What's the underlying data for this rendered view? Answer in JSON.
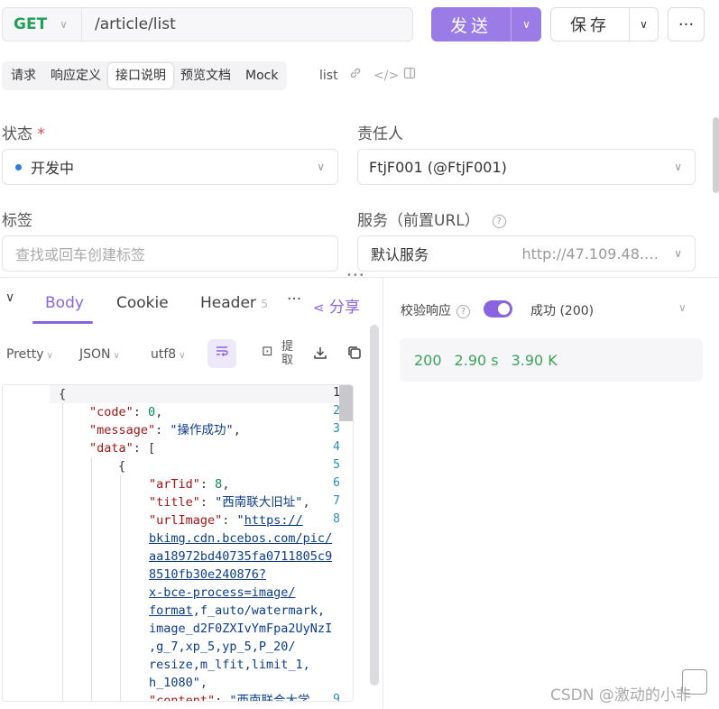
{
  "request": {
    "method": "GET",
    "url": "/article/list",
    "send_label": "发送",
    "save_label": "保存",
    "more_label": "···"
  },
  "tabs": [
    "请求",
    "响应定义",
    "接口说明",
    "预览文档",
    "Mock"
  ],
  "active_tab": "接口说明",
  "tab_extra": "list",
  "form": {
    "status_label": "状态",
    "status_required": "*",
    "status_value": "开发中",
    "owner_label": "责任人",
    "owner_value": "FtjF001 (@FtjF001)",
    "tags_label": "标签",
    "tags_placeholder": "查找或回车创建标签",
    "service_label": "服务（前置URL）",
    "service_value": "默认服务",
    "service_url": "http://47.109.48.…"
  },
  "response_tabs": {
    "body": "Body",
    "cookie": "Cookie",
    "header": "Header",
    "header_count": "5",
    "more": "···",
    "share": "分享"
  },
  "format_bar": {
    "pretty": "Pretty",
    "json": "JSON",
    "encoding": "utf8",
    "extract": "提取"
  },
  "code_lines": {
    "n": [
      "1",
      "2",
      "3",
      "4",
      "5",
      "6",
      "7",
      "8",
      "9"
    ],
    "l1": "{",
    "l2k": "\"code\"",
    "l2v": "0",
    "l3k": "\"message\"",
    "l3v": "\"操作成功\"",
    "l4k": "\"data\"",
    "l4v": "[",
    "l5": "{",
    "l6k": "\"arTid\"",
    "l6v": "8",
    "l7k": "\"title\"",
    "l7v": "\"西南联大旧址\"",
    "l8k": "\"urlImage\"",
    "l8q": "\"",
    "l8a": "https://",
    "l8b": "bkimg.cdn.bcebos.com/pic/",
    "l8c": "aa18972bd40735fa0711805c9",
    "l8d": "8510fb30e240876?",
    "l8e": "x-bce-process=image/",
    "l8f": "format",
    "l8g": ",f_auto/watermark,",
    "l8h": "image_d2F0ZXIvYmFpa2UyNzI",
    "l8i": ",g_7,xp_5,yp_5,P_20/",
    "l8j": "resize,m_lfit,limit_1,",
    "l8k2": "h_1080\",",
    "l9k": "\"content\"",
    "l9v": "\"西南联合大学"
  },
  "validate": {
    "label": "校验响应",
    "result": "成功 (200)"
  },
  "response_status": {
    "code": "200",
    "time": "2.90 s",
    "size": "3.90 K"
  },
  "watermark": "CSDN @激动的小非",
  "colors": {
    "accent": "#8a63e0",
    "send_bg": "#9b7be6",
    "method_get": "#22a05a",
    "status_ok": "#3aa55a"
  }
}
